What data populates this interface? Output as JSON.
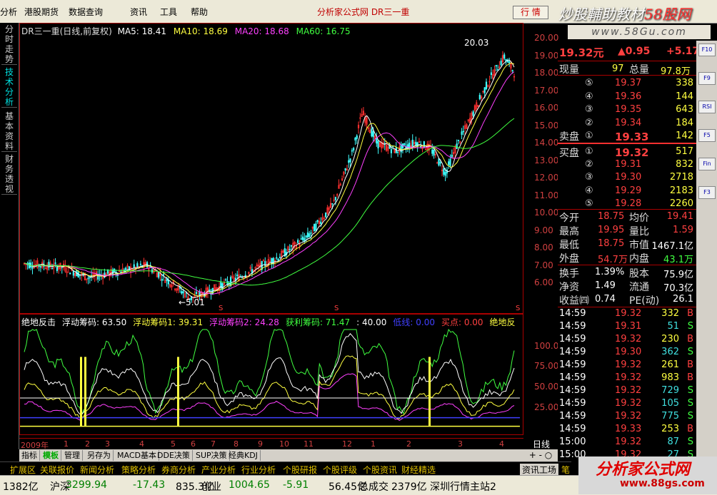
{
  "menu": {
    "items": [
      "分析",
      "港股期货",
      "数据查询",
      "资讯",
      "工具",
      "帮助"
    ],
    "app_title": "分析家公式网  DR三一重",
    "market_button": "行 情"
  },
  "watermark": {
    "top_text": "炒股輔助教材",
    "top_accent": "58股网",
    "top_url": "www.58Gu.com",
    "bottom_text": "分析家公式网",
    "bottom_url": "www.88gs.com"
  },
  "left_tabs": [
    "分时走势",
    "技术分析",
    "基本资料",
    "财务透视"
  ],
  "main_chart": {
    "title": "DR三一重(日线,前复权)",
    "ma": [
      {
        "label": "MA5: 18.41",
        "color": "#ffffff"
      },
      {
        "label": "MA10: 18.69",
        "color": "#ffff40"
      },
      {
        "label": "MA20: 18.68",
        "color": "#ff40ff"
      },
      {
        "label": "MA60: 16.75",
        "color": "#40ff40"
      }
    ],
    "high_annotation": "20.03",
    "low_annotation": "←5.01",
    "axis_labels": [
      "20.00",
      "19.00",
      "18.00",
      "17.00",
      "16.00",
      "15.00",
      "14.00",
      "13.00",
      "12.00",
      "11.00",
      "10.00",
      "9.00",
      "8.00",
      "7.00",
      "6.00"
    ],
    "markers": [
      "S",
      "S",
      "S"
    ]
  },
  "indicator": {
    "items": [
      {
        "label": "绝地反击",
        "color": "#ffffff"
      },
      {
        "label": "浮动筹码: 63.50",
        "color": "#ffffff"
      },
      {
        "label": "浮动筹码1: 39.31",
        "color": "#ffff40"
      },
      {
        "label": "浮动筹码2: 24.28",
        "color": "#ff40ff"
      },
      {
        "label": "获利筹码: 71.47",
        "color": "#40ff40"
      },
      {
        "label": ": 40.00",
        "color": "#ffffff"
      },
      {
        "label": "低线: 0.00",
        "color": "#4040ff"
      },
      {
        "label": "买点: 0.00",
        "color": "#ff4040"
      },
      {
        "label": "绝地反",
        "color": "#ffff40"
      }
    ],
    "axis_labels": [
      "100.0",
      "75.00",
      "50.00",
      "25.00"
    ]
  },
  "dates": [
    "2009年",
    "1",
    "2",
    "3",
    "4",
    "5",
    "6",
    "7",
    "8",
    "9",
    "10",
    "11",
    "12",
    "1",
    "2",
    "3",
    "4"
  ],
  "period": "日线",
  "tabs": [
    "指标",
    "模板",
    "管理",
    "另存为",
    "MACD基本",
    "DDE决策",
    "SUP决策",
    "经典KDJ"
  ],
  "zoom": "+ - ○",
  "funcbar": [
    "扩展区",
    "关联报价",
    "新闻分析",
    "策略分析",
    "券商分析",
    "产业分析",
    "行业分析",
    "个股研报",
    "个股评级",
    "个股资讯",
    "财经精选",
    "资讯工场",
    "笔"
  ],
  "statusbar": [
    "1382亿",
    "沪深",
    "3299.94",
    "-17.43",
    "835.3亿",
    "创业",
    "1004.65",
    "-5.91",
    "56.45亿",
    "总成交",
    "2379亿",
    "深圳行情主站2"
  ],
  "quote": {
    "price": "19.32元",
    "change": "▲0.95",
    "change_pct": "+5.17",
    "volume_now_label": "现量",
    "volume_now": "97",
    "total_volume_label": "总量",
    "total_volume": "97.8万",
    "sell_label": "卖盘",
    "buy_label": "买盘",
    "asks": [
      {
        "level": "⑤",
        "price": "19.37",
        "vol": "338"
      },
      {
        "level": "④",
        "price": "19.36",
        "vol": "144"
      },
      {
        "level": "③",
        "price": "19.35",
        "vol": "643"
      },
      {
        "level": "②",
        "price": "19.34",
        "vol": "184"
      },
      {
        "level": "①",
        "price": "19.33",
        "vol": "142"
      }
    ],
    "bids": [
      {
        "level": "①",
        "price": "19.32",
        "vol": "517"
      },
      {
        "level": "②",
        "price": "19.31",
        "vol": "832"
      },
      {
        "level": "③",
        "price": "19.30",
        "vol": "2718"
      },
      {
        "level": "④",
        "price": "19.29",
        "vol": "2183"
      },
      {
        "level": "⑤",
        "price": "19.28",
        "vol": "2260"
      }
    ],
    "stats": [
      {
        "l1": "今开",
        "v1": "18.75",
        "l2": "均价",
        "v2": "19.41"
      },
      {
        "l1": "最高",
        "v1": "19.95",
        "l2": "量比",
        "v2": "1.59"
      },
      {
        "l1": "最低",
        "v1": "18.75",
        "l2": "市值",
        "v2": "1467.1亿"
      },
      {
        "l1": "外盘",
        "v1": "54.7万",
        "l2": "内盘",
        "v2": "43.1万"
      }
    ],
    "fund": [
      {
        "l1": "换手",
        "v1": "1.39%",
        "l2": "股本",
        "v2": "75.9亿"
      },
      {
        "l1": "净资",
        "v1": "1.49",
        "l2": "流通",
        "v2": "70.3亿"
      },
      {
        "l1": "收益㈣",
        "v1": "0.74",
        "l2": "PE(动)",
        "v2": "26.1"
      }
    ],
    "ticks": [
      {
        "t": "14:59",
        "p": "19.32",
        "v": "332",
        "d": "B"
      },
      {
        "t": "14:59",
        "p": "19.31",
        "v": "51",
        "d": "S"
      },
      {
        "t": "14:59",
        "p": "19.32",
        "v": "230",
        "d": "B"
      },
      {
        "t": "14:59",
        "p": "19.30",
        "v": "362",
        "d": "S"
      },
      {
        "t": "14:59",
        "p": "19.32",
        "v": "261",
        "d": "B"
      },
      {
        "t": "14:59",
        "p": "19.32",
        "v": "983",
        "d": "B"
      },
      {
        "t": "14:59",
        "p": "19.32",
        "v": "729",
        "d": "S"
      },
      {
        "t": "14:59",
        "p": "19.32",
        "v": "105",
        "d": "S"
      },
      {
        "t": "14:59",
        "p": "19.32",
        "v": "775",
        "d": "S"
      },
      {
        "t": "14:59",
        "p": "19.33",
        "v": "253",
        "d": "B"
      },
      {
        "t": "15:00",
        "p": "19.32",
        "v": "87",
        "d": "S"
      },
      {
        "t": "15:00",
        "p": "19.32",
        "v": "27",
        "d": "S"
      }
    ]
  },
  "side_icons": [
    "F10",
    "F9",
    "RSI",
    "F5",
    "Fin",
    "F3"
  ]
}
